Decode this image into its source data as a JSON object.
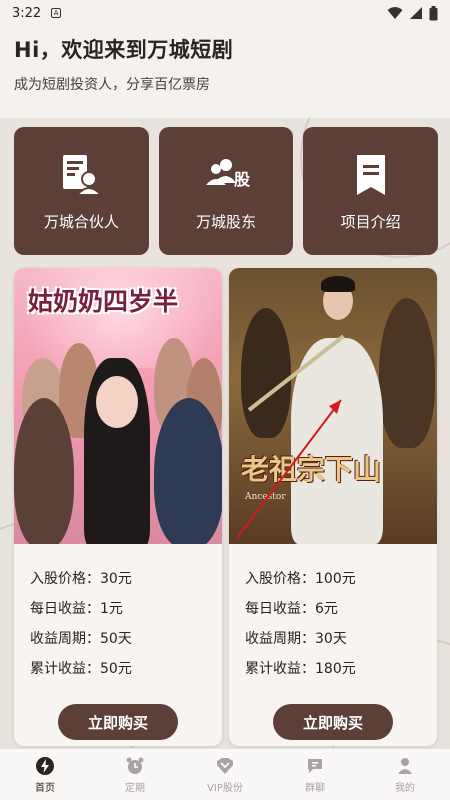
{
  "status_bar": {
    "time": "3:22",
    "sim_label": "A"
  },
  "header": {
    "title": "Hi，欢迎来到万城短剧",
    "subtitle": "成为短剧投资人，分享百亿票房"
  },
  "menu": [
    {
      "label": "万城合伙人",
      "icon": "partner-document-icon"
    },
    {
      "label": "万城股东",
      "icon": "shareholders-icon"
    },
    {
      "label": "项目介绍",
      "icon": "bookmark-document-icon"
    }
  ],
  "cards": [
    {
      "poster_title": "姑奶奶四岁半",
      "poster_subtitle": "",
      "rows": [
        {
          "label": "入股价格：",
          "value": "30元"
        },
        {
          "label": "每日收益：",
          "value": "1元"
        },
        {
          "label": "收益周期：",
          "value": "50天"
        },
        {
          "label": "累计收益：",
          "value": "50元"
        }
      ],
      "button": "立即购买"
    },
    {
      "poster_title": "老祖宗下山",
      "poster_subtitle": "Ancestor",
      "rows": [
        {
          "label": "入股价格：",
          "value": "100元"
        },
        {
          "label": "每日收益：",
          "value": "6元"
        },
        {
          "label": "收益周期：",
          "value": "30天"
        },
        {
          "label": "累计收益：",
          "value": "180元"
        }
      ],
      "button": "立即购买"
    }
  ],
  "tabs": [
    {
      "label": "首页",
      "icon": "home-lightning-icon",
      "active": true
    },
    {
      "label": "定期",
      "icon": "alarm-clock-icon",
      "active": false
    },
    {
      "label": "VIP股份",
      "icon": "vip-heart-icon",
      "active": false
    },
    {
      "label": "群聊",
      "icon": "chat-icon",
      "active": false
    },
    {
      "label": "我的",
      "icon": "user-icon",
      "active": false
    }
  ],
  "colors": {
    "brand": "#5c4038",
    "background": "#f4f1ee",
    "tab_inactive": "#a9a2a6"
  }
}
